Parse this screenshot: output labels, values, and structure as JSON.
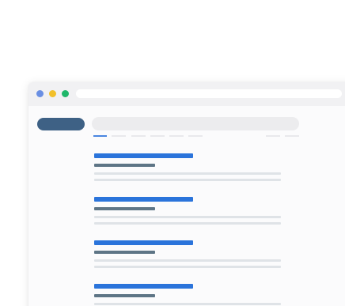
{
  "colors": {
    "dot_blue": "#6a8fe3",
    "dot_yellow": "#f2c02a",
    "dot_green": "#1fb76a",
    "logo": "#3e6185",
    "result_title": "#2b74db",
    "result_url": "#5e7586",
    "tab_active": "#4a85e0"
  },
  "results": [
    {
      "title_icon": "placeholder-title-bar",
      "url_icon": "placeholder-url-bar",
      "lines": 2
    },
    {
      "title_icon": "placeholder-title-bar",
      "url_icon": "placeholder-url-bar",
      "lines": 2
    },
    {
      "title_icon": "placeholder-title-bar",
      "url_icon": "placeholder-url-bar",
      "lines": 2
    },
    {
      "title_icon": "placeholder-title-bar",
      "url_icon": "placeholder-url-bar",
      "lines": 2
    }
  ]
}
